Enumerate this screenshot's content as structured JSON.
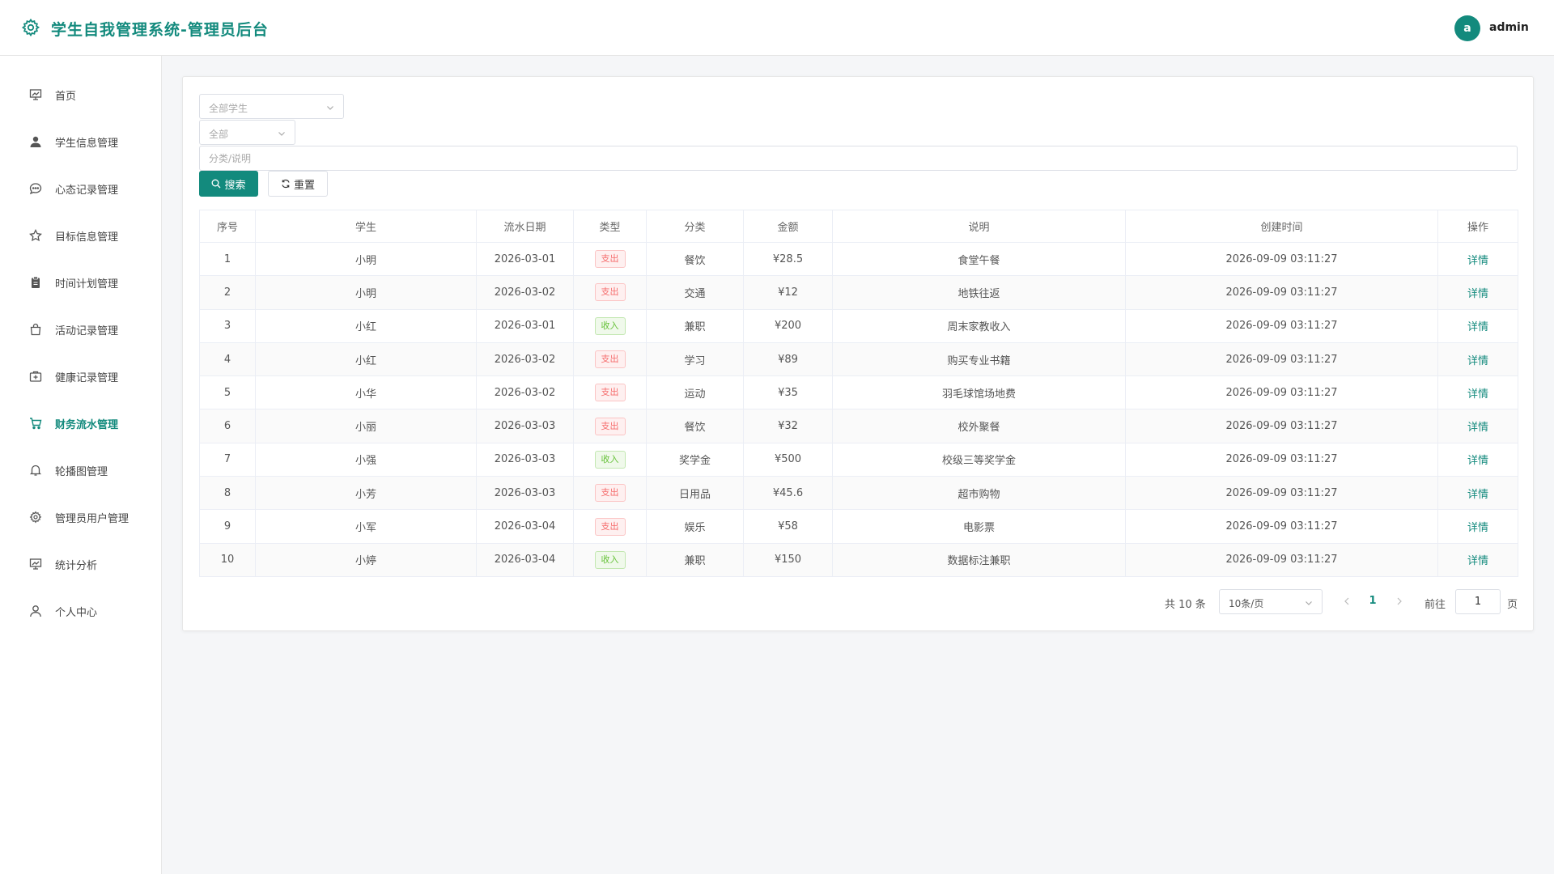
{
  "header": {
    "title": "学生自我管理系统-管理员后台",
    "avatar_letter": "a",
    "username": "admin"
  },
  "colors": {
    "brand": "#138a7d",
    "expense_tag": "#f56c6c",
    "income_tag": "#67c23a"
  },
  "sidebar": {
    "items": [
      {
        "label": "首页",
        "icon": "dashboard-icon",
        "active": false
      },
      {
        "label": "学生信息管理",
        "icon": "user-icon",
        "active": false
      },
      {
        "label": "心态记录管理",
        "icon": "chat-icon",
        "active": false
      },
      {
        "label": "目标信息管理",
        "icon": "star-icon",
        "active": false
      },
      {
        "label": "时间计划管理",
        "icon": "clipboard-icon",
        "active": false
      },
      {
        "label": "活动记录管理",
        "icon": "bag-icon",
        "active": false
      },
      {
        "label": "健康记录管理",
        "icon": "first-aid-icon",
        "active": false
      },
      {
        "label": "财务流水管理",
        "icon": "cart-icon",
        "active": true
      },
      {
        "label": "轮播图管理",
        "icon": "bell-icon",
        "active": false
      },
      {
        "label": "管理员用户管理",
        "icon": "gear-icon",
        "active": false
      },
      {
        "label": "统计分析",
        "icon": "chart-icon",
        "active": false
      },
      {
        "label": "个人中心",
        "icon": "person-icon",
        "active": false
      }
    ]
  },
  "filters": {
    "student_select": "全部学生",
    "type_select": "全部",
    "keyword_placeholder": "分类/说明",
    "search_label": "搜索",
    "reset_label": "重置"
  },
  "table": {
    "columns": [
      "序号",
      "学生",
      "流水日期",
      "类型",
      "分类",
      "金额",
      "说明",
      "创建时间",
      "操作"
    ],
    "rows": [
      {
        "no": "1",
        "student": "小明",
        "date": "2026-03-01",
        "type": "支出",
        "category": "餐饮",
        "amount": "¥28.5",
        "desc": "食堂午餐",
        "created": "2026-09-09 03:11:27",
        "action": "详情"
      },
      {
        "no": "2",
        "student": "小明",
        "date": "2026-03-02",
        "type": "支出",
        "category": "交通",
        "amount": "¥12",
        "desc": "地铁往返",
        "created": "2026-09-09 03:11:27",
        "action": "详情"
      },
      {
        "no": "3",
        "student": "小红",
        "date": "2026-03-01",
        "type": "收入",
        "category": "兼职",
        "amount": "¥200",
        "desc": "周末家教收入",
        "created": "2026-09-09 03:11:27",
        "action": "详情"
      },
      {
        "no": "4",
        "student": "小红",
        "date": "2026-03-02",
        "type": "支出",
        "category": "学习",
        "amount": "¥89",
        "desc": "购买专业书籍",
        "created": "2026-09-09 03:11:27",
        "action": "详情"
      },
      {
        "no": "5",
        "student": "小华",
        "date": "2026-03-02",
        "type": "支出",
        "category": "运动",
        "amount": "¥35",
        "desc": "羽毛球馆场地费",
        "created": "2026-09-09 03:11:27",
        "action": "详情"
      },
      {
        "no": "6",
        "student": "小丽",
        "date": "2026-03-03",
        "type": "支出",
        "category": "餐饮",
        "amount": "¥32",
        "desc": "校外聚餐",
        "created": "2026-09-09 03:11:27",
        "action": "详情"
      },
      {
        "no": "7",
        "student": "小强",
        "date": "2026-03-03",
        "type": "收入",
        "category": "奖学金",
        "amount": "¥500",
        "desc": "校级三等奖学金",
        "created": "2026-09-09 03:11:27",
        "action": "详情"
      },
      {
        "no": "8",
        "student": "小芳",
        "date": "2026-03-03",
        "type": "支出",
        "category": "日用品",
        "amount": "¥45.6",
        "desc": "超市购物",
        "created": "2026-09-09 03:11:27",
        "action": "详情"
      },
      {
        "no": "9",
        "student": "小军",
        "date": "2026-03-04",
        "type": "支出",
        "category": "娱乐",
        "amount": "¥58",
        "desc": "电影票",
        "created": "2026-09-09 03:11:27",
        "action": "详情"
      },
      {
        "no": "10",
        "student": "小婷",
        "date": "2026-03-04",
        "type": "收入",
        "category": "兼职",
        "amount": "¥150",
        "desc": "数据标注兼职",
        "created": "2026-09-09 03:11:27",
        "action": "详情"
      }
    ]
  },
  "pagination": {
    "total_text": "共 10 条",
    "page_size": "10条/页",
    "current_page": "1",
    "goto_label": "前往",
    "goto_value": "1",
    "page_unit": "页"
  }
}
